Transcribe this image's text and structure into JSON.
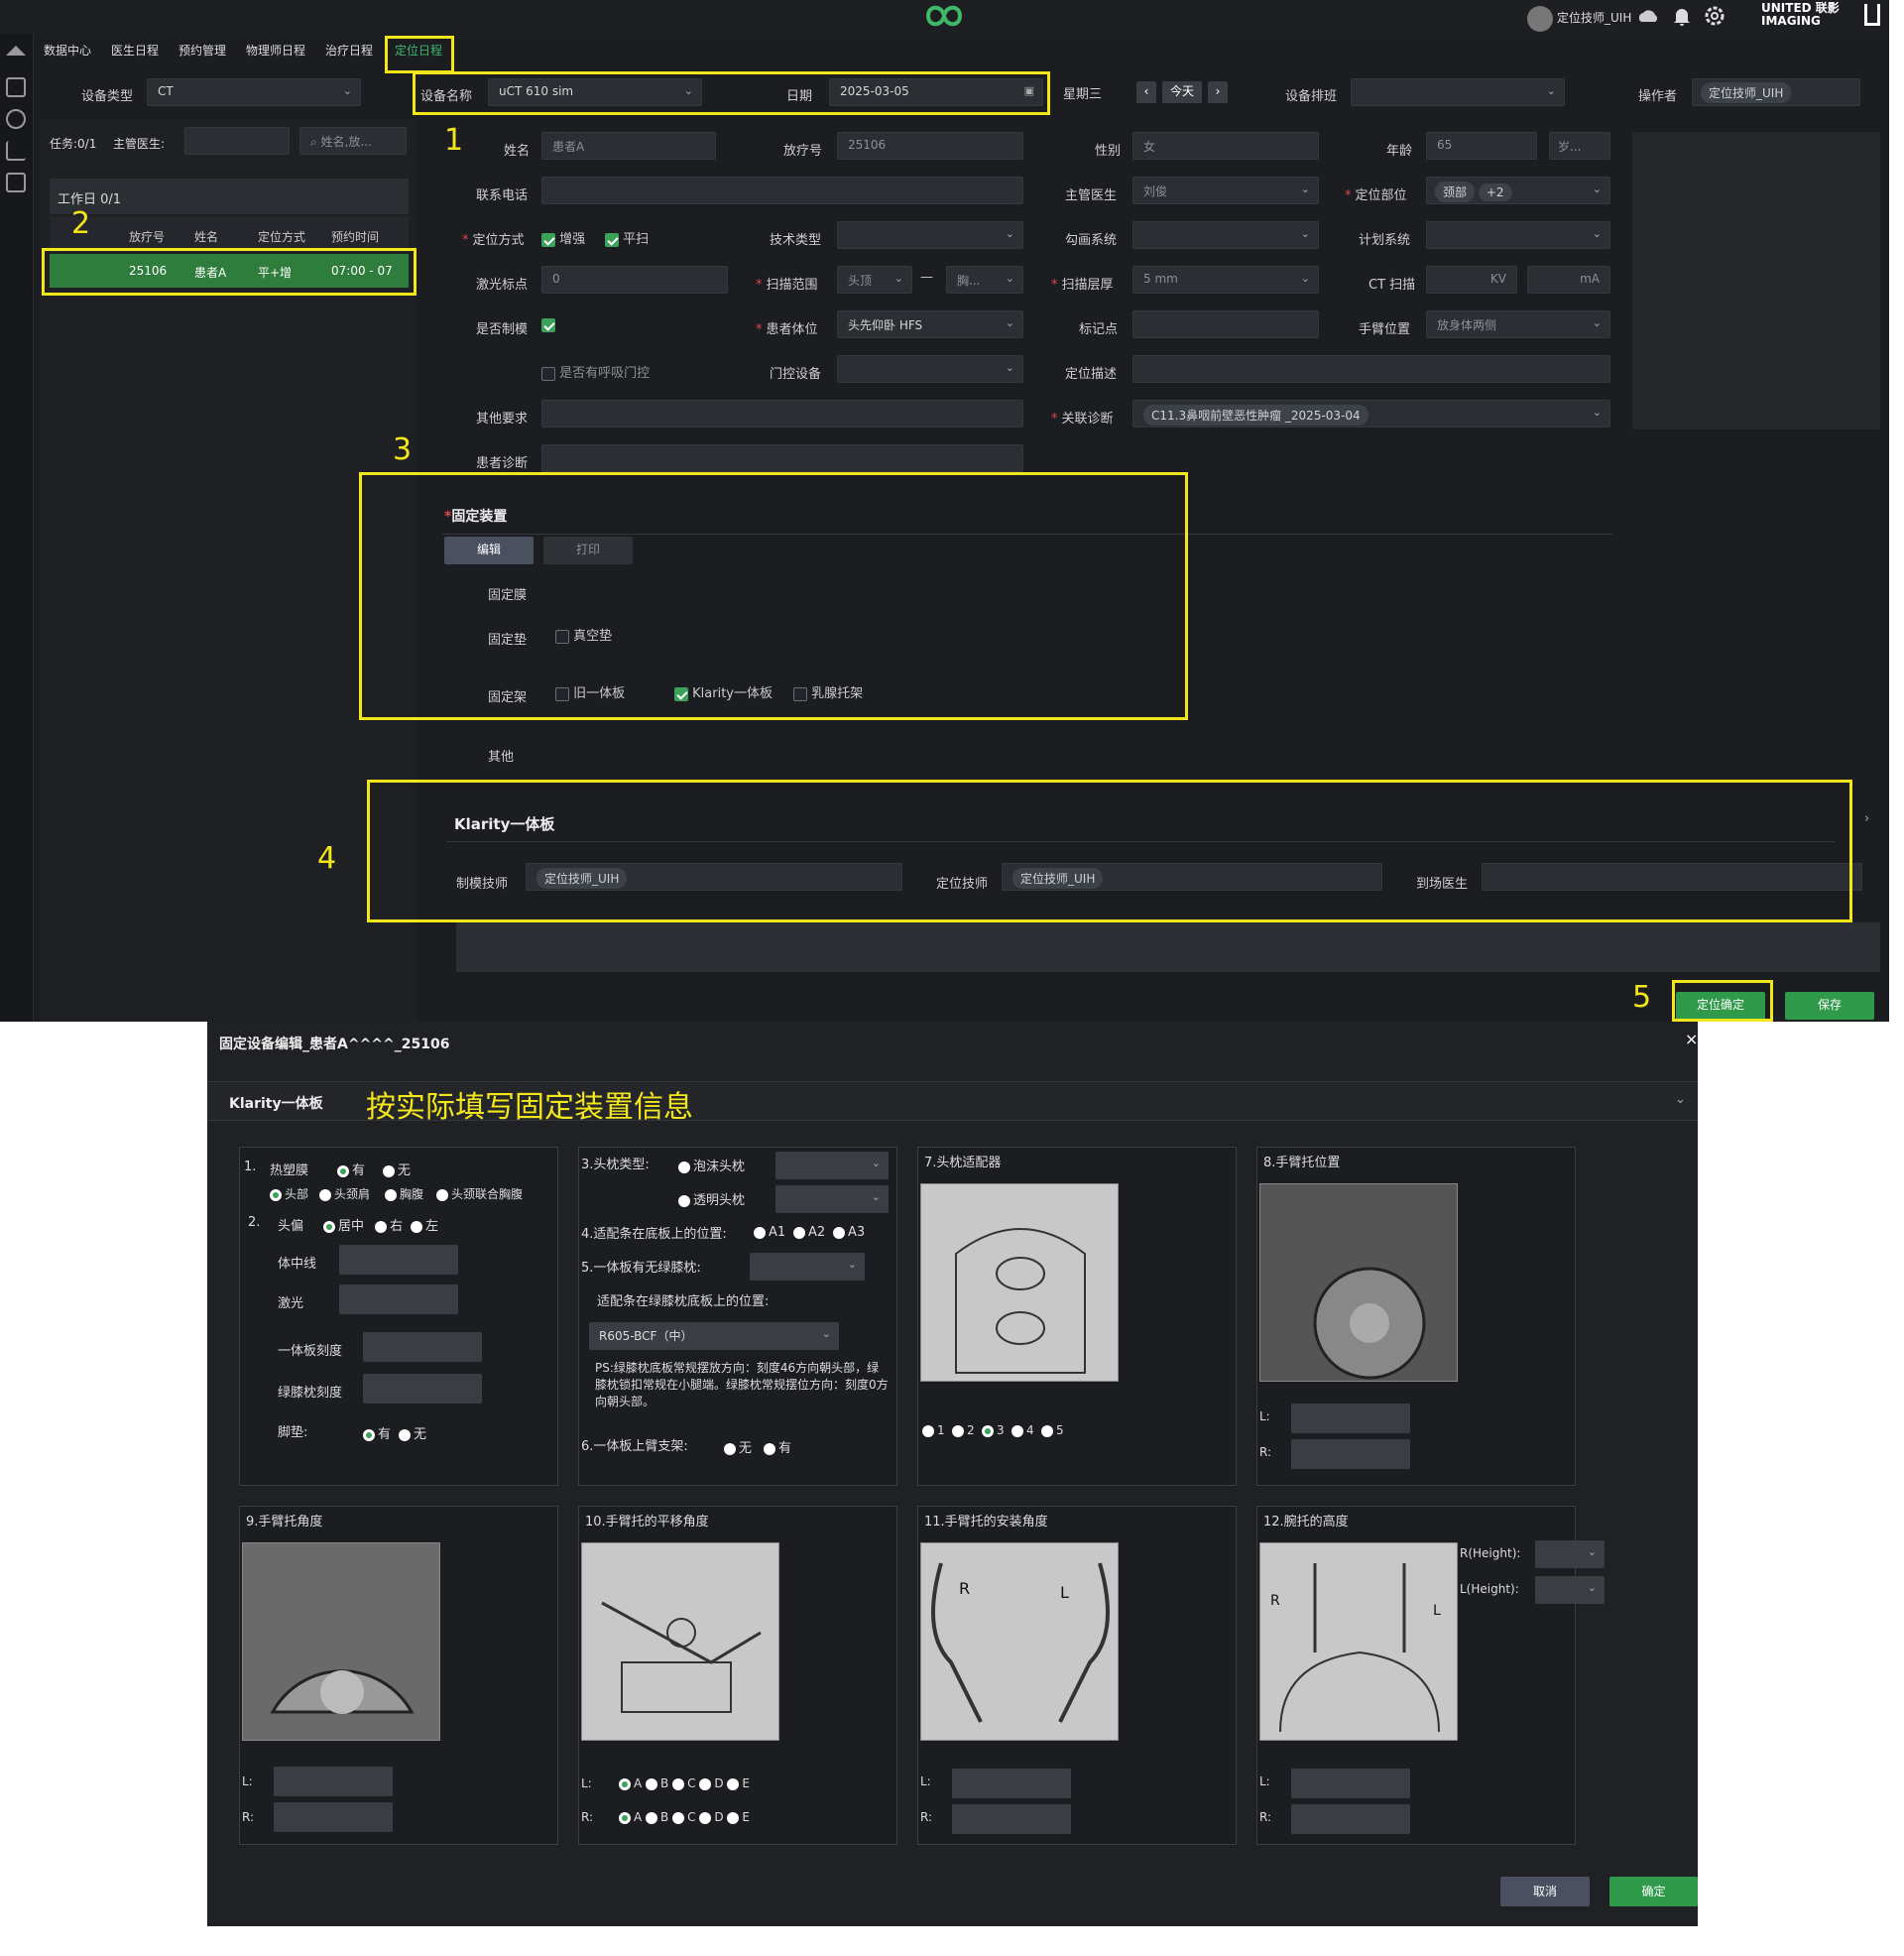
{
  "topbar": {
    "user": "定位技师_UIH",
    "brand": "UNITED 联影 IMAGING"
  },
  "tabs": [
    "数据中心",
    "医生日程",
    "预约管理",
    "物理师日程",
    "治疗日程",
    "定位日程"
  ],
  "filter": {
    "device_type_label": "设备类型",
    "device_type": "CT",
    "device_name_label": "设备名称",
    "device_name": "uCT 610 sim",
    "date_label": "日期",
    "date": "2025-03-05",
    "weekday": "星期三",
    "today": "今天",
    "device_schedule_label": "设备排班",
    "operator_label": "操作者",
    "operator": "定位技师_UIH"
  },
  "left": {
    "task": "任务:0/1",
    "doctor_label": "主管医生:",
    "search_placeholder": "姓名,放...",
    "workday": "工作日 0/1",
    "headers": [
      "放疗号",
      "姓名",
      "定位方式",
      "预约时间"
    ],
    "row": [
      "25106",
      "患者A",
      "平+增",
      "07:00 - 07"
    ]
  },
  "form": {
    "name_label": "姓名",
    "name": "患者A",
    "rtno_label": "放疗号",
    "rtno": "25106",
    "sex_label": "性别",
    "sex": "女",
    "age_label": "年龄",
    "age": "65",
    "age_unit": "岁...",
    "phone_label": "联系电话",
    "doctor_label": "主管医生",
    "doctor": "刘俊",
    "site_label": "定位部位",
    "site": "颈部",
    "site_more": "+2",
    "method_label": "定位方式",
    "method1": "增强",
    "method2": "平扫",
    "tech_label": "技术类型",
    "contour_label": "勾画系统",
    "plan_label": "计划系统",
    "laser_label": "激光标点",
    "laser": "0",
    "range_label": "扫描范围",
    "range_from": "头顶",
    "range_to": "胸...",
    "thickness_label": "扫描层厚",
    "thickness": "5 mm",
    "ctscan_label": "CT 扫描",
    "kv": "KV",
    "ma": "mA",
    "mold_label": "是否制模",
    "pos_label": "患者体位",
    "pos": "头先仰卧 HFS",
    "mark_label": "标记点",
    "arm_label": "手臂位置",
    "arm": "放身体两侧",
    "breath_label": "是否有呼吸门控",
    "gate_label": "门控设备",
    "desc_label": "定位描述",
    "other_req_label": "其他要求",
    "diag_rel_label": "关联诊断",
    "diag_rel": "C11.3鼻咽前壁恶性肿瘤 _2025-03-04",
    "diag_label": "患者诊断"
  },
  "fixation": {
    "title": "固定装置",
    "edit": "编辑",
    "print": "打印",
    "membrane_label": "固定膜",
    "pad_label": "固定垫",
    "pad1": "真空垫",
    "frame_label": "固定架",
    "frame1": "旧一体板",
    "frame2": "Klarity一体板",
    "frame3": "乳腺托架",
    "other_label": "其他"
  },
  "klarity": {
    "title": "Klarity一体板",
    "maker_label": "制模技师",
    "maker": "定位技师_UIH",
    "loc_label": "定位技师",
    "loc": "定位技师_UIH",
    "arrive_label": "到场医生"
  },
  "actions": {
    "confirm": "定位确定",
    "save": "保存"
  },
  "annotations": [
    "1",
    "2",
    "3",
    "4",
    "5"
  ],
  "dialog": {
    "title": "固定设备编辑_患者A^^^^_25106",
    "section": "Klarity一体板",
    "hint": "按实际填写固定装置信息",
    "c1": {
      "l1": "1.",
      "l1b": "热塑膜",
      "yes": "有",
      "no": "无",
      "opts": [
        "头部",
        "头颈肩",
        "胸腹",
        "头颈联合胸腹"
      ],
      "l2": "2.",
      "l2b": "头偏",
      "h1": "居中",
      "h2": "右",
      "h3": "左",
      "midline": "体中线",
      "laser": "激光",
      "board_scale": "一体板刻度",
      "knee_scale": "绿膝枕刻度",
      "foot": "脚垫:",
      "fyes": "有",
      "fno": "无"
    },
    "c2": {
      "l3": "3.头枕类型:",
      "p1": "泡沫头枕",
      "p2": "透明头枕",
      "l4": "4.适配条在底板上的位置:",
      "a1": "A1",
      "a2": "A2",
      "a3": "A3",
      "l5": "5.一体板有无绿膝枕:",
      "l5b": "适配条在绿膝枕底板上的位置:",
      "sel": "R605-BCF（中）",
      "ps": "PS:绿膝枕底板常规摆放方向：刻度46方向朝头部，绿膝枕锁扣常规在小腿端。绿膝枕常规摆位方向：刻度0方向朝头部。",
      "l6": "6.一体板上臂支架:",
      "s1": "无",
      "s2": "有"
    },
    "c3": {
      "title": "7.头枕适配器",
      "opts": [
        "1",
        "2",
        "3",
        "4",
        "5"
      ]
    },
    "c4": {
      "title": "8.手臂托位置",
      "l": "L:",
      "r": "R:"
    },
    "c5": {
      "title": "9.手臂托角度",
      "l": "L:",
      "r": "R:"
    },
    "c6": {
      "title": "10.手臂托的平移角度",
      "l": "L:",
      "r": "R:",
      "opts": [
        "A",
        "B",
        "C",
        "D",
        "E"
      ]
    },
    "c7": {
      "title": "11.手臂托的安装角度",
      "l": "L:",
      "r": "R:",
      "rl": "R",
      "ll": "L"
    },
    "c8": {
      "title": "12.腕托的高度",
      "rh": "R(Height):",
      "lh": "L(Height):",
      "l": "L:",
      "r": "R:",
      "rl": "R",
      "ll": "L"
    },
    "cancel": "取消",
    "ok": "确定"
  }
}
